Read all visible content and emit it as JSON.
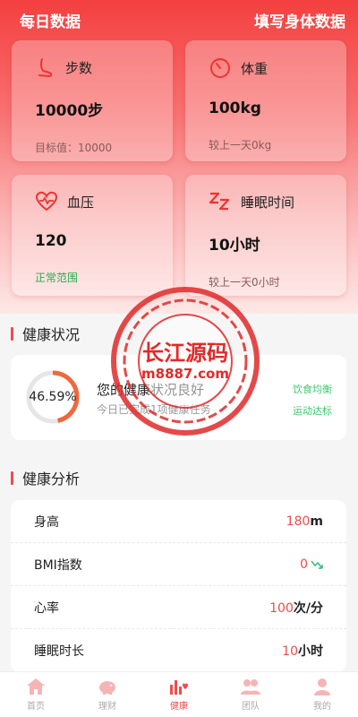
{
  "header": {
    "title": "每日数据",
    "action": "填写身体数据"
  },
  "cards": [
    {
      "label": "步数",
      "value": "10000步",
      "sub": "目标值：10000",
      "icon": "foot-icon"
    },
    {
      "label": "体重",
      "value": "100kg",
      "sub": "较上一天0kg",
      "icon": "gauge-icon"
    },
    {
      "label": "血压",
      "value": "120",
      "sub": "正常范围",
      "icon": "heart-pulse-icon"
    },
    {
      "label": "睡眠时间",
      "value": "10小时",
      "sub": "较上一天0小时",
      "icon": "sleep-icon"
    }
  ],
  "status": {
    "section_title": "健康状况",
    "percent_text": "46.59%",
    "percent": 46.59,
    "main_text": "您的健康状况良好",
    "sub_text": "今日已完成1项健康任务",
    "tags": [
      "饮食均衡",
      "运动达标"
    ]
  },
  "analysis": {
    "section_title": "健康分析",
    "rows": [
      {
        "label": "身高",
        "num": "180",
        "unit": "m"
      },
      {
        "label": "BMI指数",
        "num": "0",
        "unit": ""
      },
      {
        "label": "心率",
        "num": "100",
        "unit": "次/分"
      },
      {
        "label": "睡眠时长",
        "num": "10",
        "unit": "小时"
      }
    ]
  },
  "tabbar": [
    {
      "label": "首页",
      "icon": "home-icon"
    },
    {
      "label": "理财",
      "icon": "piggy-bank-icon"
    },
    {
      "label": "健康",
      "icon": "health-chart-icon",
      "active": true
    },
    {
      "label": "团队",
      "icon": "team-icon"
    },
    {
      "label": "我的",
      "icon": "user-icon"
    }
  ],
  "watermark": {
    "line1": "长江源码",
    "line2": "m8887.com"
  },
  "colors": {
    "accent": "#f24b4b",
    "green": "#2fa84f",
    "ring": "#f0683c"
  }
}
